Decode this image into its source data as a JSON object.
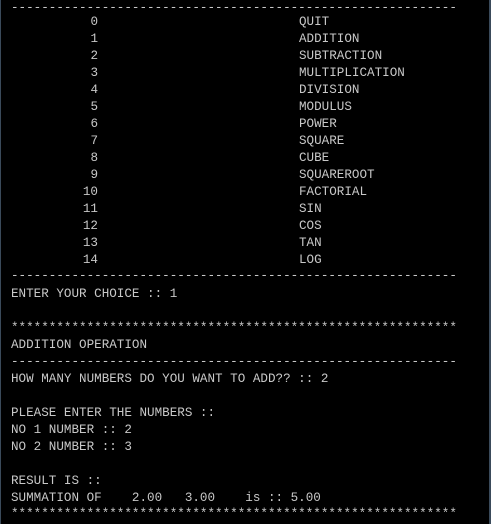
{
  "console": {
    "rule_dash": "-----------------------------------------------------------",
    "rule_star": "***********************************************************",
    "menu": [
      {
        "num": "0",
        "label": "QUIT"
      },
      {
        "num": "1",
        "label": "ADDITION"
      },
      {
        "num": "2",
        "label": "SUBTRACTION"
      },
      {
        "num": "3",
        "label": "MULTIPLICATION"
      },
      {
        "num": "4",
        "label": "DIVISION"
      },
      {
        "num": "5",
        "label": "MODULUS"
      },
      {
        "num": "6",
        "label": "POWER"
      },
      {
        "num": "7",
        "label": "SQUARE"
      },
      {
        "num": "8",
        "label": "CUBE"
      },
      {
        "num": "9",
        "label": "SQUAREROOT"
      },
      {
        "num": "10",
        "label": "FACTORIAL"
      },
      {
        "num": "11",
        "label": "SIN"
      },
      {
        "num": "12",
        "label": "COS"
      },
      {
        "num": "13",
        "label": "TAN"
      },
      {
        "num": "14",
        "label": "LOG"
      }
    ],
    "choice_prompt": "ENTER YOUR CHOICE :: 1",
    "operation_title": "ADDITION OPERATION",
    "count_prompt": "HOW MANY NUMBERS DO YOU WANT TO ADD?? :: 2",
    "enter_numbers": "PLEASE ENTER THE NUMBERS ::",
    "inputs": [
      "NO 1 NUMBER :: 2",
      "NO 2 NUMBER :: 3"
    ],
    "result_label": "RESULT IS ::",
    "result_line": "SUMMATION OF    2.00   3.00    is :: 5.00"
  },
  "colors": {
    "background": "#000000",
    "text": "#c8c8c8"
  }
}
